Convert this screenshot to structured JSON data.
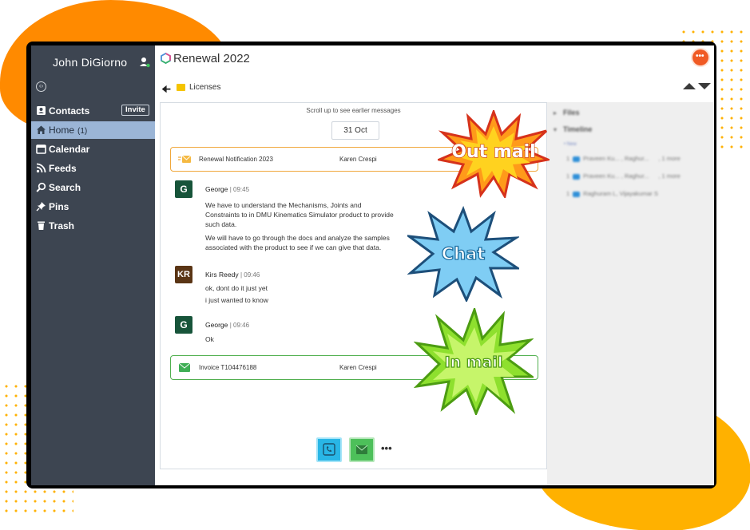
{
  "sidebar": {
    "user_name": "John DiGiorno",
    "nav": {
      "contacts": "Contacts",
      "invite": "Invite",
      "home": "Home",
      "home_count": "(1)",
      "calendar": "Calendar",
      "feeds": "Feeds",
      "search": "Search",
      "pins": "Pins",
      "trash": "Trash"
    }
  },
  "header": {
    "title": "Renewal 2022",
    "breadcrumb": "Licenses"
  },
  "conversation": {
    "scroll_hint": "Scroll up to see earlier messages",
    "date": "31 Oct",
    "out_mail": {
      "subject": "Renewal Notification 2023",
      "sender": "Karen Crespi"
    },
    "messages": [
      {
        "initials": "G",
        "author": "George",
        "time": "| 09:45",
        "lines": [
          "We have to understand the Mechanisms, Joints and",
          "Constraints to in DMU Kinematics Simulator product to provide",
          "such data.",
          "We will have to go through the docs and analyze the samples",
          "associated with the product to see if we can give that data."
        ]
      },
      {
        "initials": "KR",
        "author": "Kirs Reedy",
        "time": "| 09:46",
        "lines": [
          "ok, dont do it just yet",
          "i just wanted to know"
        ]
      },
      {
        "initials": "G",
        "author": "George",
        "time": "| 09:46",
        "lines": [
          "Ok"
        ]
      }
    ],
    "in_mail": {
      "subject": "Invoice T104476188",
      "sender": "Karen Crespi"
    },
    "more": "•••"
  },
  "side_panel": {
    "files": "Files",
    "timeline": "Timeline",
    "new_label": "• New",
    "rows": [
      {
        "count": "1",
        "people": "Praveen Ku... , Raghur...",
        "more": ", 1 more"
      },
      {
        "count": "1",
        "people": "Praveen Ku... , Raghur...",
        "more": ", 1 more"
      },
      {
        "count": "1",
        "people": "Raghuram L, Vijayakumar S",
        "more": ""
      }
    ]
  },
  "annotations": {
    "out_mail": "Out mail",
    "chat": "Chat",
    "in_mail": "In mail"
  },
  "colors": {
    "sidebar_bg": "#3d4551",
    "active_nav": "#9bb5d6",
    "out_mail_border": "#f0a83c",
    "in_mail_border": "#52b050",
    "notification": "#f05a24"
  }
}
